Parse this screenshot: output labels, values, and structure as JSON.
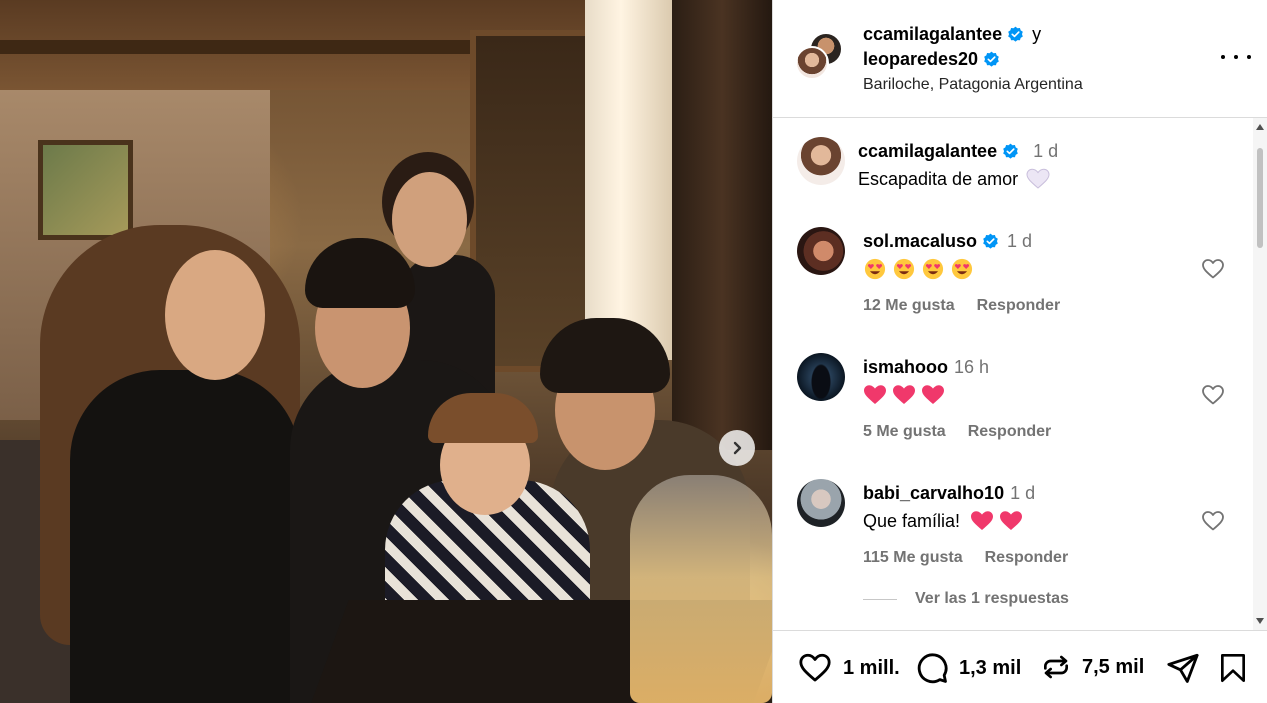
{
  "post": {
    "author1": "ccamilagalantee",
    "joiner": "y",
    "author2": "leoparedes20",
    "location": "Bariloche, Patagonia Argentina"
  },
  "caption": {
    "username": "ccamilagalantee",
    "time": "1 d",
    "text": "Escapadita de amor"
  },
  "comments": [
    {
      "username": "sol.macaluso",
      "verified": true,
      "time": "1 d",
      "text": "",
      "emojis": [
        "heart-eyes-emoji",
        "heart-eyes-emoji",
        "heart-eyes-emoji",
        "heart-eyes-emoji"
      ],
      "likes": "12 Me gusta",
      "reply": "Responder"
    },
    {
      "username": "ismahooo",
      "verified": false,
      "time": "16 h",
      "text": "",
      "emojis": [
        "pink-heart-emoji",
        "pink-heart-emoji",
        "pink-heart-emoji"
      ],
      "likes": "5 Me gusta",
      "reply": "Responder"
    },
    {
      "username": "babi_carvalho10",
      "verified": false,
      "time": "1 d",
      "text": "Que família!",
      "emojis": [
        "pink-heart-emoji",
        "pink-heart-emoji"
      ],
      "likes": "115 Me gusta",
      "reply": "Responder"
    }
  ],
  "replies_link": "Ver las 1 respuestas",
  "actions": {
    "likes": "1 mill.",
    "comments": "1,3 mil",
    "reposts": "7,5 mil"
  },
  "colors": {
    "verified": "#0095f6",
    "muted_text": "#737373",
    "border": "#dbdbdb",
    "heart_pink": "#f0386b"
  },
  "icons": {
    "like": "heart-outline-icon",
    "comment": "speech-bubble-icon",
    "repost": "repost-icon",
    "share": "paper-plane-icon",
    "save": "bookmark-icon",
    "more": "more-options-icon",
    "next": "chevron-right-icon"
  }
}
